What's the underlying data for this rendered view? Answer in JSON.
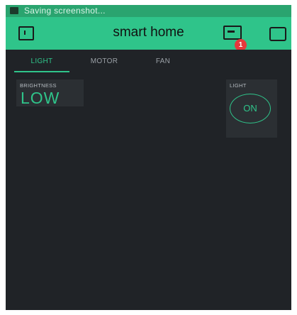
{
  "status_bar": {
    "text": "Saving screenshot..."
  },
  "app_bar": {
    "title": "smart home",
    "notification_count": "1"
  },
  "tabs": [
    {
      "label": "LIGHT",
      "active": true
    },
    {
      "label": "MOTOR",
      "active": false
    },
    {
      "label": "FAN",
      "active": false
    }
  ],
  "widgets": {
    "brightness": {
      "label": "BRIGHTNESS",
      "value": "LOW"
    },
    "light": {
      "label": "LIGHT",
      "button_label": "ON"
    }
  },
  "colors": {
    "accent": "#2fc48a",
    "status_bar": "#2aa46f",
    "background": "#202327",
    "widget": "#2b2f33",
    "badge": "#e5393c"
  },
  "icons": {
    "left": "project-settings-icon",
    "device": "device-icon",
    "right": "add-widget-icon"
  }
}
